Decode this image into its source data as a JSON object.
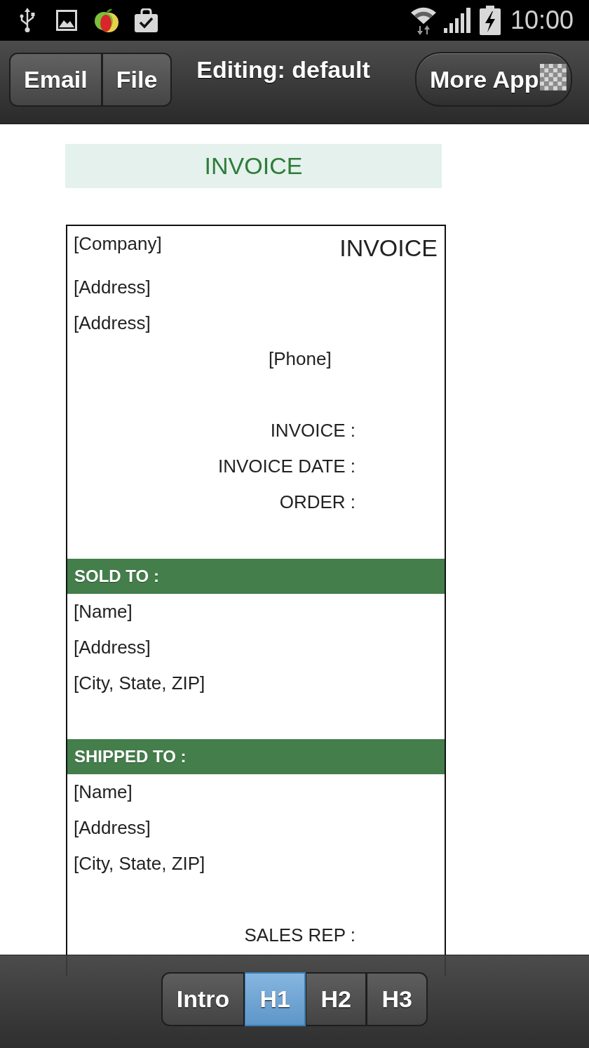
{
  "status_bar": {
    "time": "10:00"
  },
  "action_bar": {
    "buttons": [
      "Email",
      "File"
    ],
    "title": "Editing: default",
    "more_button": "More App"
  },
  "page_title": "INVOICE",
  "invoice": {
    "company": "[Company]",
    "title": "INVOICE",
    "address_lines": [
      "[Address]",
      "[Address]"
    ],
    "phone": "[Phone]",
    "details": [
      "INVOICE :",
      "INVOICE DATE :",
      "ORDER :"
    ],
    "parties": [
      {
        "heading": "SOLD TO :",
        "lines": [
          "[Name]",
          "[Address]",
          "[City, State, ZIP]"
        ]
      },
      {
        "heading": "SHIPPED TO :",
        "lines": [
          "[Name]",
          "[Address]",
          "[City, State, ZIP]"
        ]
      }
    ],
    "shipping_details": [
      "SALES REP :"
    ]
  },
  "bottom_tabs": [
    {
      "label": "Intro",
      "selected": false
    },
    {
      "label": "H1",
      "selected": true
    },
    {
      "label": "H2",
      "selected": false
    },
    {
      "label": "H3",
      "selected": false
    }
  ]
}
